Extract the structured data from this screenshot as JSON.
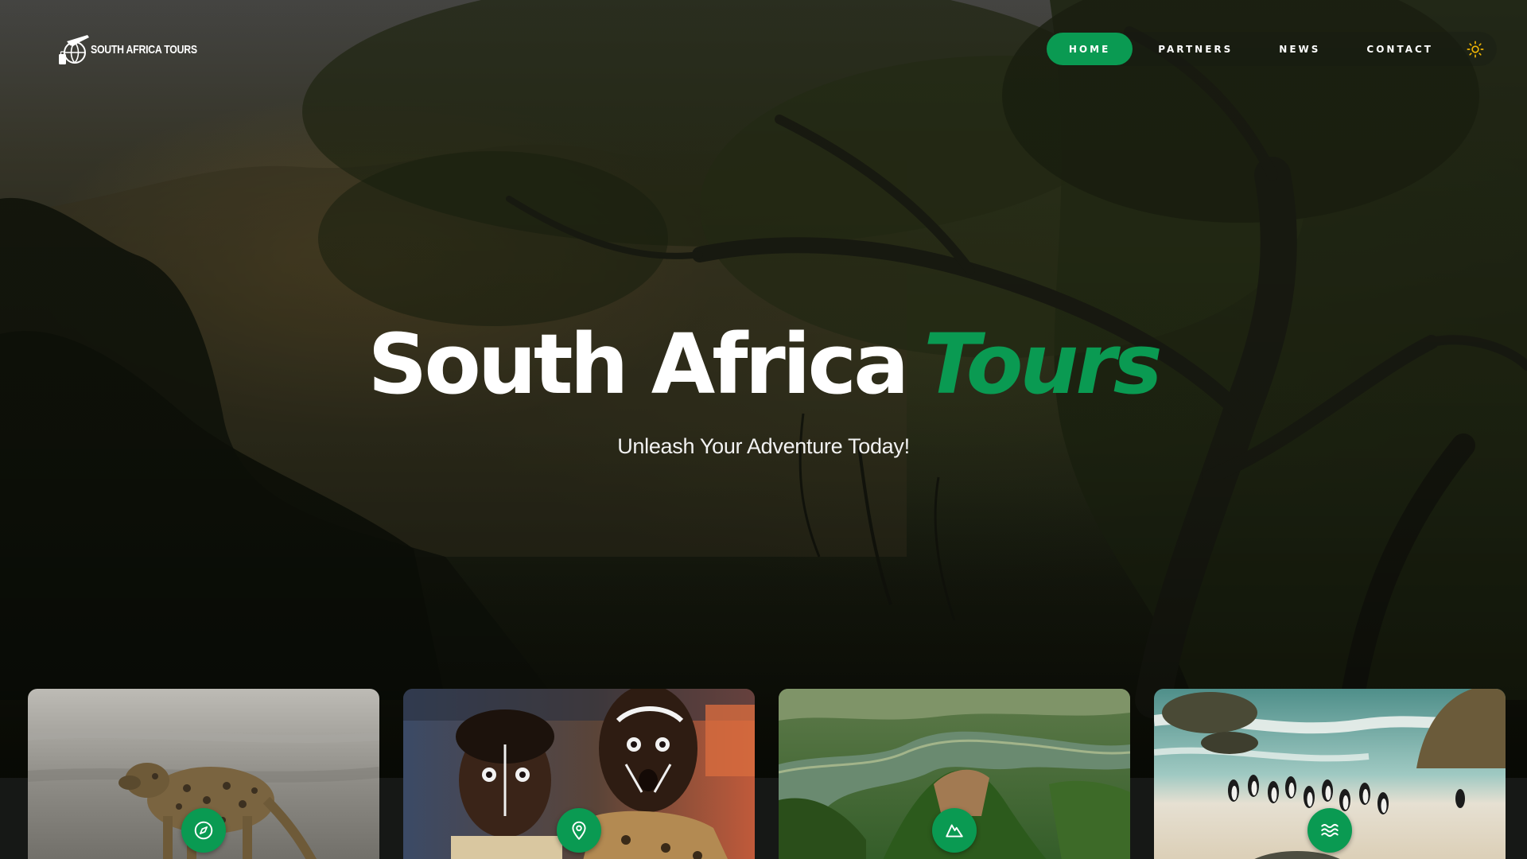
{
  "brand": {
    "logo_text": "SOUTH AFRICA TOURS",
    "logo_icon": "globe-plane-luggage-icon"
  },
  "nav": {
    "items": [
      {
        "label": "HOME",
        "active": true
      },
      {
        "label": "PARTNERS",
        "active": false
      },
      {
        "label": "NEWS",
        "active": false
      },
      {
        "label": "CONTACT",
        "active": false
      }
    ],
    "theme_toggle_icon": "sun-icon"
  },
  "hero": {
    "title_main": "South Africa",
    "title_accent": "Tours",
    "subtitle": "Unleash Your Adventure Today!"
  },
  "cards": [
    {
      "image": "hyena-photo",
      "icon": "compass-icon"
    },
    {
      "image": "face-painted-people-photo",
      "icon": "map-pin-icon"
    },
    {
      "image": "river-canyon-photo",
      "icon": "mountain-icon"
    },
    {
      "image": "penguin-beach-photo",
      "icon": "waves-icon"
    }
  ],
  "colors": {
    "accent": "#0a9a52",
    "sun": "#f2b705",
    "text": "#ffffff"
  }
}
